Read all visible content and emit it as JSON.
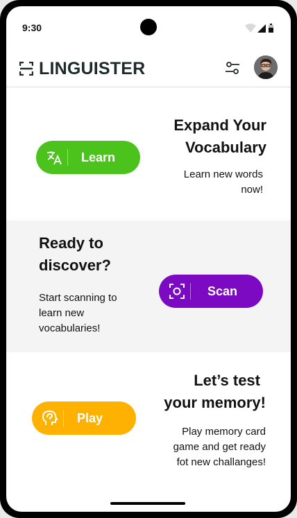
{
  "status_bar": {
    "time": "9:30"
  },
  "header": {
    "brand": "LINGUISTER",
    "logo_icon": "scan-frame-icon",
    "settings_icon": "filter-sliders-icon",
    "avatar": "user-avatar"
  },
  "sections": {
    "learn": {
      "title_line1": "Expand Your",
      "title_line2": "Vocabulary",
      "desc_line1": "Learn new words",
      "desc_line2": "now!",
      "button_label": "Learn",
      "button_icon": "translate-icon",
      "color": "#4cc21d"
    },
    "scan": {
      "title_line1": "Ready to",
      "title_line2": "discover?",
      "desc_line1": "Start scanning to",
      "desc_line2": "learn new",
      "desc_line3": "vocabularies!",
      "button_label": "Scan",
      "button_icon": "scan-icon",
      "color": "#7b0ac2"
    },
    "play": {
      "title_line1": "Let’s test",
      "title_line2": "your memory!",
      "desc_line1": "Play memory card",
      "desc_line2": "game and get ready",
      "desc_line3": "fot new challanges!",
      "button_label": "Play",
      "button_icon": "brain-head-icon",
      "color": "#ffb100"
    }
  }
}
